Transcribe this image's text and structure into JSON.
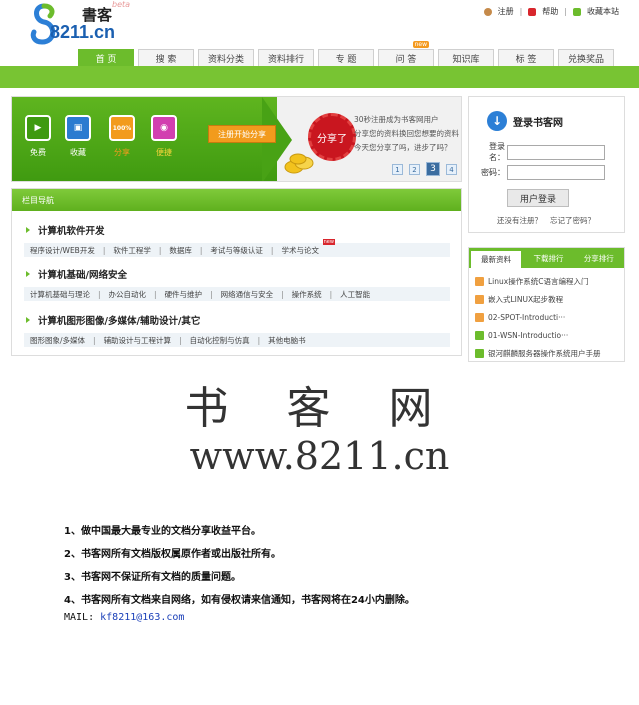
{
  "logo": {
    "site_name": "書客",
    "beta": "beta",
    "url_text": "8211.cn"
  },
  "toplinks": {
    "register": "注册",
    "help": "帮助",
    "favorite": "收藏本站"
  },
  "nav": {
    "tabs": [
      {
        "label": "首  页",
        "active": true,
        "hot": ""
      },
      {
        "label": "搜  索",
        "active": false,
        "hot": ""
      },
      {
        "label": "资料分类",
        "active": false,
        "hot": ""
      },
      {
        "label": "资料排行",
        "active": false,
        "hot": ""
      },
      {
        "label": "专  题",
        "active": false,
        "hot": ""
      },
      {
        "label": "问  答",
        "active": false,
        "hot": "new"
      },
      {
        "label": "知识库",
        "active": false,
        "hot": ""
      },
      {
        "label": "标  签",
        "active": false,
        "hot": ""
      },
      {
        "label": "兑换奖品",
        "active": false,
        "hot": ""
      }
    ]
  },
  "banner": {
    "features": [
      {
        "label": "免费",
        "color": "#3f9a10",
        "glyph": "▶"
      },
      {
        "label": "收藏",
        "color": "#2b7bd0",
        "glyph": "▣"
      },
      {
        "label": "分享",
        "color": "#f29b1d",
        "glyph": "100%"
      },
      {
        "label": "便捷",
        "color": "#d23fb0",
        "glyph": "◉"
      }
    ],
    "share_button": "注册开始分享",
    "badge": "分享了",
    "text_lines": [
      "30秒注册成为书客网用户",
      "分享您的资料换回您想要的资料",
      "今天您分享了吗，进步了吗？"
    ],
    "pages": [
      "1",
      "2",
      "3",
      "4"
    ],
    "current_page": "3"
  },
  "login": {
    "title": "登录书客网",
    "username_label": "登录名：",
    "password_label": "密码：",
    "button": "用户登录",
    "register_link": "还没有注册？",
    "forgot_link": "忘记了密码？"
  },
  "colnav": {
    "heading": "栏目导航",
    "categories": [
      {
        "title": "计算机软件开发",
        "subs": [
          "程序设计/WEB开发",
          "软件工程学",
          "数据库",
          "考试与等级认证",
          "学术与论文"
        ]
      },
      {
        "title": "计算机基础/网络安全",
        "subs": [
          "计算机基础与理论",
          "办公自动化",
          "硬件与维护",
          "网络通信与安全",
          "操作系统",
          "人工智能"
        ]
      },
      {
        "title": "计算机图形图像/多媒体/辅助设计/其它",
        "subs": [
          "图形图象/多媒体",
          "辅助设计与工程计算",
          "自动化控制与仿真",
          "其他电脑书"
        ]
      }
    ],
    "new_tag": "new"
  },
  "rtabs": {
    "tabs": [
      "最新资料",
      "下载排行",
      "分享排行"
    ],
    "items": [
      {
        "text": "Linux操作系统C语言编程入门",
        "color": "#f0a040"
      },
      {
        "text": "嵌入式LINUX起步教程",
        "color": "#f0a040"
      },
      {
        "text": "02-SPOT-Introducti···",
        "color": "#f0a040"
      },
      {
        "text": "01-WSN-Introductio···",
        "color": "#6cbc2c"
      },
      {
        "text": "银河麒麟服务器操作系统用户手册",
        "color": "#6cbc2c"
      }
    ]
  },
  "watermark": {
    "title": "书 客 网",
    "url": "www.8211.cn",
    "notices": [
      "1、做中国最大最专业的文档分享收益平台。",
      "2、书客网所有文档版权属原作者或出版社所有。",
      "3、书客网不保证所有文档的质量问题。",
      "4、书客网所有文档来自网络，如有侵权请来信通知，书客网将在24小内删除。"
    ],
    "mail_label": "MAIL:",
    "mail_address": "kf8211@163.com"
  }
}
